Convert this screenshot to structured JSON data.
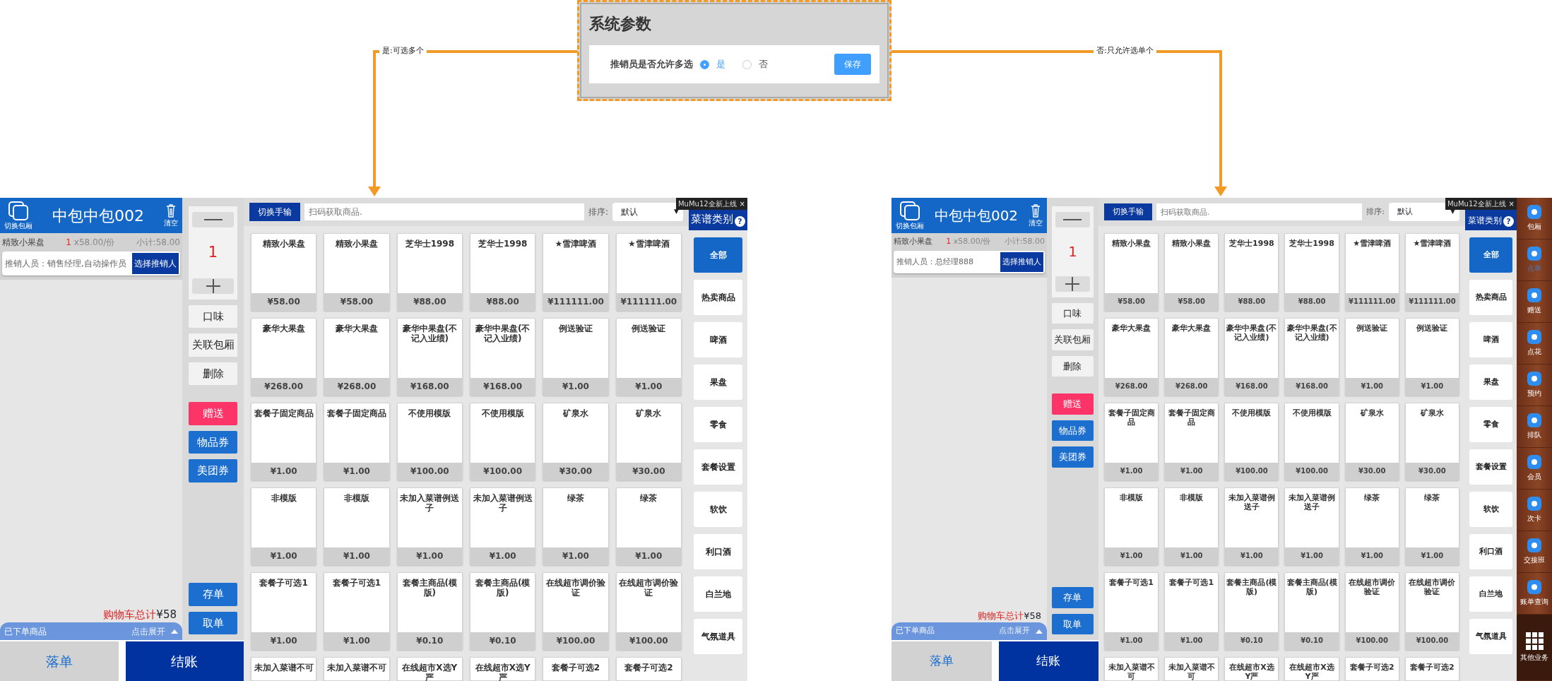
{
  "dialog": {
    "title": "系统参数",
    "label": "推销员是否允许多选",
    "options": [
      {
        "label": "是",
        "selected": true
      },
      {
        "label": "否",
        "selected": false
      }
    ],
    "button": "保存"
  },
  "annotations": [
    {
      "label": "是:可选多个"
    },
    {
      "label": "否:只允许选单个"
    }
  ],
  "screens": [
    {
      "room_switch": "切换包厢",
      "title": "中包中包002",
      "clear": "清空",
      "cart_items": [
        {
          "name": "精致小果盘",
          "qty": "1",
          "unit": "x58.00/份",
          "subtotal": "小计:58.00",
          "salesperson": "推销人员：销售经理,自动操作员",
          "pick_button": "选择推销人"
        }
      ],
      "cart_total_label": "购物车总计",
      "cart_total": "¥58",
      "ordered_bar": {
        "label": "已下单商品",
        "toggle": "点击展开"
      },
      "qty": "1",
      "actions": [
        {
          "label": "口味",
          "kind": "plain"
        },
        {
          "label": "关联包厢",
          "kind": "plain"
        },
        {
          "label": "删除",
          "kind": "plain"
        },
        {
          "label": "赠送",
          "kind": "gift"
        },
        {
          "label": "物品券",
          "kind": "coupon"
        },
        {
          "label": "美团券",
          "kind": "coupon"
        }
      ],
      "actions_bottom": [
        {
          "label": "存单",
          "kind": "coupon"
        },
        {
          "label": "取单",
          "kind": "coupon"
        }
      ],
      "footer_buttons": [
        {
          "label": "落单",
          "kind": "secondary"
        },
        {
          "label": "结账",
          "kind": "primary"
        }
      ],
      "toolbar": {
        "switch_button": "切换手输",
        "search_placeholder": "扫码获取商品.",
        "sort_label": "排序:",
        "sort_value": "默认",
        "sort_caret": "▼"
      },
      "products": [
        {
          "name": "精致小果盘",
          "price": "¥58.00"
        },
        {
          "name": "精致小果盘",
          "price": "¥58.00"
        },
        {
          "name": "芝华士1998",
          "price": "¥88.00"
        },
        {
          "name": "芝华士1998",
          "price": "¥88.00"
        },
        {
          "name": "★雪津啤酒",
          "price": "¥111111.00"
        },
        {
          "name": "★雪津啤酒",
          "price": "¥111111.00"
        },
        {
          "name": "豪华大果盘",
          "price": "¥268.00"
        },
        {
          "name": "豪华大果盘",
          "price": "¥268.00"
        },
        {
          "name": "豪华中果盘(不记入业绩)",
          "price": "¥168.00"
        },
        {
          "name": "豪华中果盘(不记入业绩)",
          "price": "¥168.00"
        },
        {
          "name": "例送验证",
          "price": "¥1.00"
        },
        {
          "name": "例送验证",
          "price": "¥1.00"
        },
        {
          "name": "套餐子固定商品",
          "price": "¥1.00"
        },
        {
          "name": "套餐子固定商品",
          "price": "¥1.00"
        },
        {
          "name": "不使用模版",
          "price": "¥100.00"
        },
        {
          "name": "不使用模版",
          "price": "¥100.00"
        },
        {
          "name": "矿泉水",
          "price": "¥30.00"
        },
        {
          "name": "矿泉水",
          "price": "¥30.00"
        },
        {
          "name": "非模版",
          "price": "¥1.00"
        },
        {
          "name": "非模版",
          "price": "¥1.00"
        },
        {
          "name": "未加入菜谱例送子",
          "price": "¥1.00"
        },
        {
          "name": "未加入菜谱例送子",
          "price": "¥1.00"
        },
        {
          "name": "绿茶",
          "price": "¥1.00"
        },
        {
          "name": "绿茶",
          "price": "¥1.00"
        },
        {
          "name": "套餐子可选1",
          "price": "¥1.00"
        },
        {
          "name": "套餐子可选1",
          "price": "¥1.00"
        },
        {
          "name": "套餐主商品(模版)",
          "price": "¥0.10"
        },
        {
          "name": "套餐主商品(模版)",
          "price": "¥0.10"
        },
        {
          "name": "在线超市调价验证",
          "price": "¥100.00"
        },
        {
          "name": "在线超市调价验证",
          "price": "¥100.00"
        },
        {
          "name": "未加入菜谱不可"
        },
        {
          "name": "未加入菜谱不可"
        },
        {
          "name": "在线超市X选Y严"
        },
        {
          "name": "在线超市X选Y严"
        },
        {
          "name": "套餐子可选2"
        },
        {
          "name": "套餐子可选2"
        }
      ],
      "category_header": "菜谱类别",
      "help": "?",
      "categories": [
        {
          "label": "全部",
          "selected": true
        },
        {
          "label": "热卖商品",
          "selected": false
        },
        {
          "label": "啤酒",
          "selected": false
        },
        {
          "label": "果盘",
          "selected": false
        },
        {
          "label": "零食",
          "selected": false
        },
        {
          "label": "套餐设置",
          "selected": false
        },
        {
          "label": "软饮",
          "selected": false
        },
        {
          "label": "利口酒",
          "selected": false
        },
        {
          "label": "白兰地",
          "selected": false
        },
        {
          "label": "气氛道具",
          "selected": false
        }
      ],
      "popup": {
        "text": "MuMu12全新上线",
        "close": "×"
      }
    },
    {
      "room_switch": "切换包厢",
      "title": "中包中包002",
      "clear": "清空",
      "cart_items": [
        {
          "name": "精致小果盘",
          "qty": "1",
          "unit": "x58.00/份",
          "subtotal": "小计:58.00",
          "salesperson": "推销人员：总经理888",
          "pick_button": "选择推销人"
        }
      ],
      "cart_total_label": "购物车总计",
      "cart_total": "¥58",
      "ordered_bar": {
        "label": "已下单商品",
        "toggle": "点击展开"
      },
      "qty": "1",
      "actions": [
        {
          "label": "口味",
          "kind": "plain"
        },
        {
          "label": "关联包厢",
          "kind": "plain"
        },
        {
          "label": "删除",
          "kind": "plain"
        },
        {
          "label": "赠送",
          "kind": "gift"
        },
        {
          "label": "物品券",
          "kind": "coupon"
        },
        {
          "label": "美团券",
          "kind": "coupon"
        }
      ],
      "actions_bottom": [
        {
          "label": "存单",
          "kind": "coupon"
        },
        {
          "label": "取单",
          "kind": "coupon"
        }
      ],
      "footer_buttons": [
        {
          "label": "落单",
          "kind": "secondary"
        },
        {
          "label": "结账",
          "kind": "primary"
        }
      ],
      "toolbar": {
        "switch_button": "切换手输",
        "search_placeholder": "扫码获取商品.",
        "sort_label": "排序:",
        "sort_value": "默认",
        "sort_caret": "▼"
      },
      "products": [
        {
          "name": "精致小果盘",
          "price": "¥58.00"
        },
        {
          "name": "精致小果盘",
          "price": "¥58.00"
        },
        {
          "name": "芝华士1998",
          "price": "¥88.00"
        },
        {
          "name": "芝华士1998",
          "price": "¥88.00"
        },
        {
          "name": "★雪津啤酒",
          "price": "¥111111.00"
        },
        {
          "name": "★雪津啤酒",
          "price": "¥111111.00"
        },
        {
          "name": "豪华大果盘",
          "price": "¥268.00"
        },
        {
          "name": "豪华大果盘",
          "price": "¥268.00"
        },
        {
          "name": "豪华中果盘(不记入业绩)",
          "price": "¥168.00"
        },
        {
          "name": "豪华中果盘(不记入业绩)",
          "price": "¥168.00"
        },
        {
          "name": "例送验证",
          "price": "¥1.00"
        },
        {
          "name": "例送验证",
          "price": "¥1.00"
        },
        {
          "name": "套餐子固定商品",
          "price": "¥1.00"
        },
        {
          "name": "套餐子固定商品",
          "price": "¥1.00"
        },
        {
          "name": "不使用模版",
          "price": "¥100.00"
        },
        {
          "name": "不使用模版",
          "price": "¥100.00"
        },
        {
          "name": "矿泉水",
          "price": "¥30.00"
        },
        {
          "name": "矿泉水",
          "price": "¥30.00"
        },
        {
          "name": "非模版",
          "price": "¥1.00"
        },
        {
          "name": "非模版",
          "price": "¥1.00"
        },
        {
          "name": "未加入菜谱例送子",
          "price": "¥1.00"
        },
        {
          "name": "未加入菜谱例送子",
          "price": "¥1.00"
        },
        {
          "name": "绿茶",
          "price": "¥1.00"
        },
        {
          "name": "绿茶",
          "price": "¥1.00"
        },
        {
          "name": "套餐子可选1",
          "price": "¥1.00"
        },
        {
          "name": "套餐子可选1",
          "price": "¥1.00"
        },
        {
          "name": "套餐主商品(模版)",
          "price": "¥0.10"
        },
        {
          "name": "套餐主商品(模版)",
          "price": "¥0.10"
        },
        {
          "name": "在线超市调价验证",
          "price": "¥100.00"
        },
        {
          "name": "在线超市调价验证",
          "price": "¥100.00"
        },
        {
          "name": "未加入菜谱不可"
        },
        {
          "name": "未加入菜谱不可"
        },
        {
          "name": "在线超市X选Y严"
        },
        {
          "name": "在线超市X选Y严"
        },
        {
          "name": "套餐子可选2"
        },
        {
          "name": "套餐子可选2"
        }
      ],
      "category_header": "菜谱类别",
      "help": "?",
      "categories": [
        {
          "label": "全部",
          "selected": true
        },
        {
          "label": "热卖商品",
          "selected": false
        },
        {
          "label": "啤酒",
          "selected": false
        },
        {
          "label": "果盘",
          "selected": false
        },
        {
          "label": "零食",
          "selected": false
        },
        {
          "label": "套餐设置",
          "selected": false
        },
        {
          "label": "软饮",
          "selected": false
        },
        {
          "label": "利口酒",
          "selected": false
        },
        {
          "label": "白兰地",
          "selected": false
        },
        {
          "label": "气氛道具",
          "selected": false
        }
      ],
      "popup": {
        "text": "MuMu12全新上线",
        "close": "×"
      },
      "side_nav": [
        {
          "label": "包厢",
          "kind": "app",
          "selected": false
        },
        {
          "label": "点单",
          "kind": "app",
          "selected": true
        },
        {
          "label": "赠送",
          "kind": "app",
          "selected": false
        },
        {
          "label": "点花",
          "kind": "app",
          "selected": false
        },
        {
          "label": "预约",
          "kind": "app",
          "selected": false
        },
        {
          "label": "排队",
          "kind": "app",
          "selected": false
        },
        {
          "label": "会员",
          "kind": "app",
          "selected": false
        },
        {
          "label": "次卡",
          "kind": "app",
          "selected": false
        },
        {
          "label": "交接班",
          "kind": "app",
          "selected": false
        },
        {
          "label": "账单查询",
          "kind": "app",
          "selected": false
        },
        {
          "label": "其他业务",
          "kind": "more",
          "selected": false
        }
      ]
    }
  ]
}
